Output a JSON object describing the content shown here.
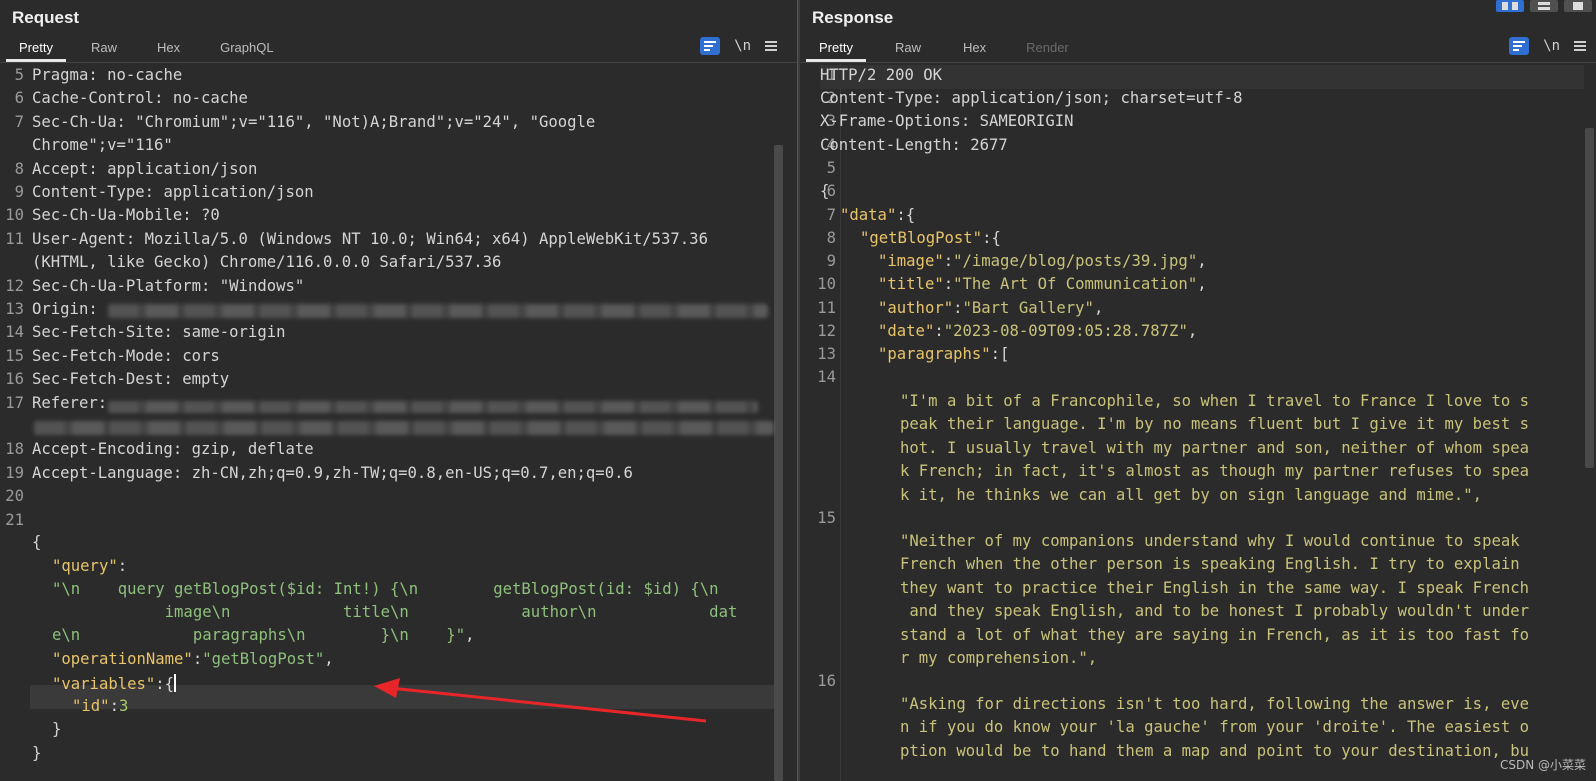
{
  "request": {
    "title": "Request",
    "tabs": [
      "Pretty",
      "Raw",
      "Hex",
      "GraphQL"
    ],
    "active_tab": "Pretty",
    "newline_toggle": "\\n",
    "lines": [
      {
        "n": "5",
        "key": "Pragma",
        "val": " no-cache"
      },
      {
        "n": "6",
        "key": "Cache-Control",
        "val": " no-cache"
      },
      {
        "n": "7",
        "key": "Sec-Ch-Ua",
        "val": " \"Chromium\";v=\"116\", \"Not)A;Brand\";v=\"24\", \"Google",
        "cont": "Chrome\";v=\"116\""
      },
      {
        "n": "8",
        "key": "Accept",
        "val": " application/json"
      },
      {
        "n": "9",
        "key": "Content-Type",
        "val": " application/json"
      },
      {
        "n": "10",
        "key": "Sec-Ch-Ua-Mobile",
        "val": " ?0"
      },
      {
        "n": "11",
        "key": "User-Agent",
        "val": " Mozilla/5.0 (Windows NT 10.0; Win64; x64) AppleWebKit/537.36",
        "cont": "(KHTML, like Gecko) Chrome/116.0.0.0 Safari/537.36"
      },
      {
        "n": "12",
        "key": "Sec-Ch-Ua-Platform",
        "val": " \"Windows\""
      },
      {
        "n": "13",
        "key": "Origin",
        "val": " "
      },
      {
        "n": "14",
        "key": "Sec-Fetch-Site",
        "val": " same-origin"
      },
      {
        "n": "15",
        "key": "Sec-Fetch-Mode",
        "val": " cors"
      },
      {
        "n": "16",
        "key": "Sec-Fetch-Dest",
        "val": " empty"
      },
      {
        "n": "17",
        "key": "Referer",
        "val": " "
      },
      {
        "n": "18",
        "key": "Accept-Encoding",
        "val": " gzip, deflate"
      },
      {
        "n": "19",
        "key": "Accept-Language",
        "val": " zh-CN,zh;q=0.9,zh-TW;q=0.8,en-US;q=0.7,en;q=0.6"
      },
      {
        "n": "20"
      },
      {
        "n": "21"
      }
    ],
    "body": {
      "open": "{",
      "query_key": "\"query\"",
      "query_l1": "\"\\n    query getBlogPost($id: Int!) {\\n        getBlogPost(id: $id) {\\n",
      "query_l2": "            image\\n            title\\n            author\\n            dat",
      "query_l3": "e\\n            paragraphs\\n        }\\n    }\"",
      "op_key": "\"operationName\"",
      "op_val": "\"getBlogPost\"",
      "vars_key": "\"variables\"",
      "id_key": "\"id\"",
      "id_val": "3",
      "close_inner": "}",
      "close": "}"
    }
  },
  "response": {
    "title": "Response",
    "tabs": [
      "Pretty",
      "Raw",
      "Hex",
      "Render"
    ],
    "active_tab": "Pretty",
    "disabled_tab": "Render",
    "newline_toggle": "\\n",
    "status": "HTTP/2 200 OK",
    "headers": [
      {
        "key": "Content-Type",
        "val": " application/json; charset=utf-8"
      },
      {
        "key": "X-Frame-Options",
        "val": " SAMEORIGIN"
      },
      {
        "key": "Content-Length",
        "val": " 2677"
      }
    ],
    "json": {
      "open": "{",
      "data_key": "\"data\"",
      "gbp_key": "\"getBlogPost\"",
      "image_key": "\"image\"",
      "image_val": "\"/image/blog/posts/39.jpg\"",
      "title_key": "\"title\"",
      "title_val": "\"The Art Of Communication\"",
      "author_key": "\"author\"",
      "author_val": "\"Bart Gallery\"",
      "date_key": "\"date\"",
      "date_val": "\"2023-08-09T09:05:28.787Z\"",
      "paragraphs_key": "\"paragraphs\""
    },
    "p1": [
      "\"I'm a bit of a Francophile, so when I travel to France I love to s",
      "peak their language. I'm by no means fluent but I give it my best s",
      "hot. I usually travel with my partner and son, neither of whom spea",
      "k French; in fact, it's almost as though my partner refuses to spea",
      "k it, he thinks we can all get by on sign language and mime.\","
    ],
    "p2": [
      "\"Neither of my companions understand why I would continue to speak",
      "French when the other person is speaking English. I try to explain",
      "they want to practice their English in the same way. I speak French",
      " and they speak English, and to be honest I probably wouldn't under",
      "stand a lot of what they are saying in French, as it is too fast fo",
      "r my comprehension.\","
    ],
    "p3": [
      "\"Asking for directions isn't too hard, following the answer is, eve",
      "n if you do know your 'la gauche' from your 'droite'. The easiest o",
      "ption would be to hand them a map and point to your destination, bu"
    ]
  },
  "watermark": "CSDN @小菜菜",
  "colors": {
    "accent": "#2f6fd1",
    "arrow": "#e8262a",
    "background": "#2b2b2b"
  }
}
